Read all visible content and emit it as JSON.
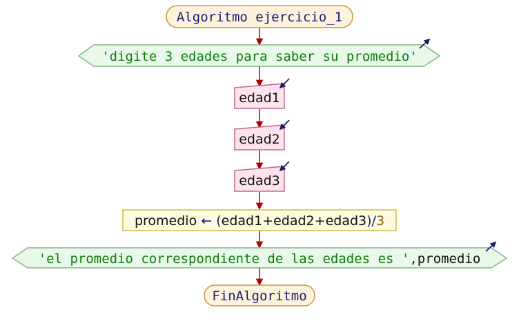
{
  "start": {
    "keyword": "Algoritmo",
    "name": "ejercicio_1"
  },
  "output1": {
    "text": "'digite 3 edades para saber su promedio'"
  },
  "inputs": [
    "edad1",
    "edad2",
    "edad3"
  ],
  "assignment": {
    "target": "promedio",
    "arrow": "←",
    "open": "(",
    "expr": "edad1+edad2+edad3",
    "close": ")/",
    "divisor": "3"
  },
  "output2": {
    "string": "'el promedio correspondiente de las edades es '",
    "sep": ",",
    "var": "promedio"
  },
  "end": {
    "keyword": "FinAlgoritmo"
  },
  "colors": {
    "terminal_fill": "#fdf3dc",
    "terminal_stroke": "#c8973f",
    "output_fill": "#e9f9e9",
    "output_stroke": "#7fb77f",
    "input_fill": "#fde4ec",
    "input_stroke": "#c06a84",
    "process_fill": "#fdfbdf",
    "process_stroke": "#cbbd45",
    "arrow": "#b00000",
    "io_arrow": "#1a1a6e"
  }
}
